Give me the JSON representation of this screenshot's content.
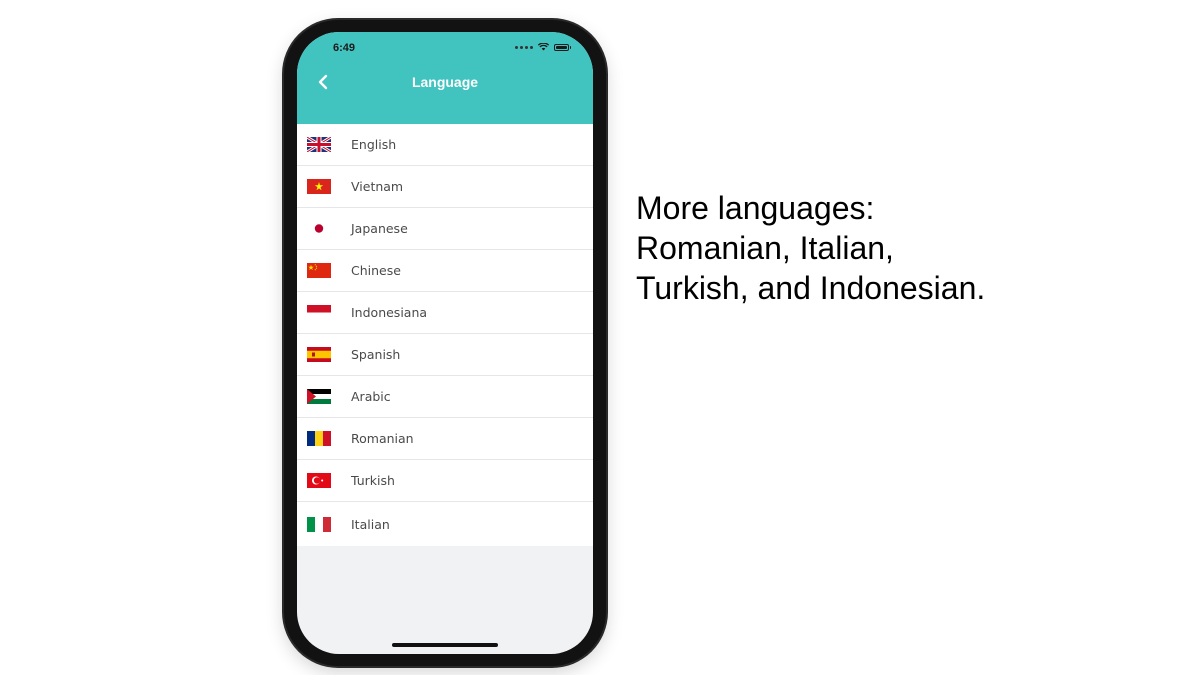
{
  "status_bar": {
    "time": "6:49"
  },
  "header": {
    "title": "Language",
    "back_icon": "chevron-left-icon"
  },
  "languages": [
    {
      "label": "English",
      "flag": "uk-flag-icon"
    },
    {
      "label": "Vietnam",
      "flag": "vietnam-flag-icon"
    },
    {
      "label": "Japanese",
      "flag": "japan-flag-icon"
    },
    {
      "label": "Chinese",
      "flag": "china-flag-icon"
    },
    {
      "label": "Indonesiana",
      "flag": "indonesia-flag-icon"
    },
    {
      "label": "Spanish",
      "flag": "spain-flag-icon"
    },
    {
      "label": "Arabic",
      "flag": "arabic-flag-icon"
    },
    {
      "label": "Romanian",
      "flag": "romania-flag-icon"
    },
    {
      "label": "Turkish",
      "flag": "turkey-flag-icon"
    },
    {
      "label": "Italian",
      "flag": "italy-flag-icon"
    }
  ],
  "caption": {
    "line1": "More languages:",
    "line2": "Romanian, Italian,",
    "line3": "Turkish, and Indonesian."
  },
  "colors": {
    "header_bg": "#41c4c0",
    "screen_bg": "#f1f2f4"
  }
}
